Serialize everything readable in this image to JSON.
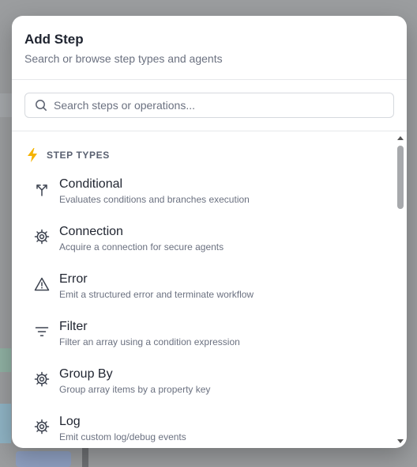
{
  "modal": {
    "title": "Add Step",
    "subtitle": "Search or browse step types and agents"
  },
  "search": {
    "placeholder": "Search steps or operations..."
  },
  "section": {
    "icon": "lightning-icon",
    "label": "STEP TYPES",
    "accent_color": "#f5b300"
  },
  "items": [
    {
      "name": "Conditional",
      "description": "Evaluates conditions and branches execution",
      "icon": "branch-icon"
    },
    {
      "name": "Connection",
      "description": "Acquire a connection for secure agents",
      "icon": "gear-icon"
    },
    {
      "name": "Error",
      "description": "Emit a structured error and terminate workflow",
      "icon": "warning-icon"
    },
    {
      "name": "Filter",
      "description": "Filter an array using a condition expression",
      "icon": "filter-icon"
    },
    {
      "name": "Group By",
      "description": "Group array items by a property key",
      "icon": "gear-icon"
    },
    {
      "name": "Log",
      "description": "Emit custom log/debug events",
      "icon": "gear-icon"
    }
  ]
}
